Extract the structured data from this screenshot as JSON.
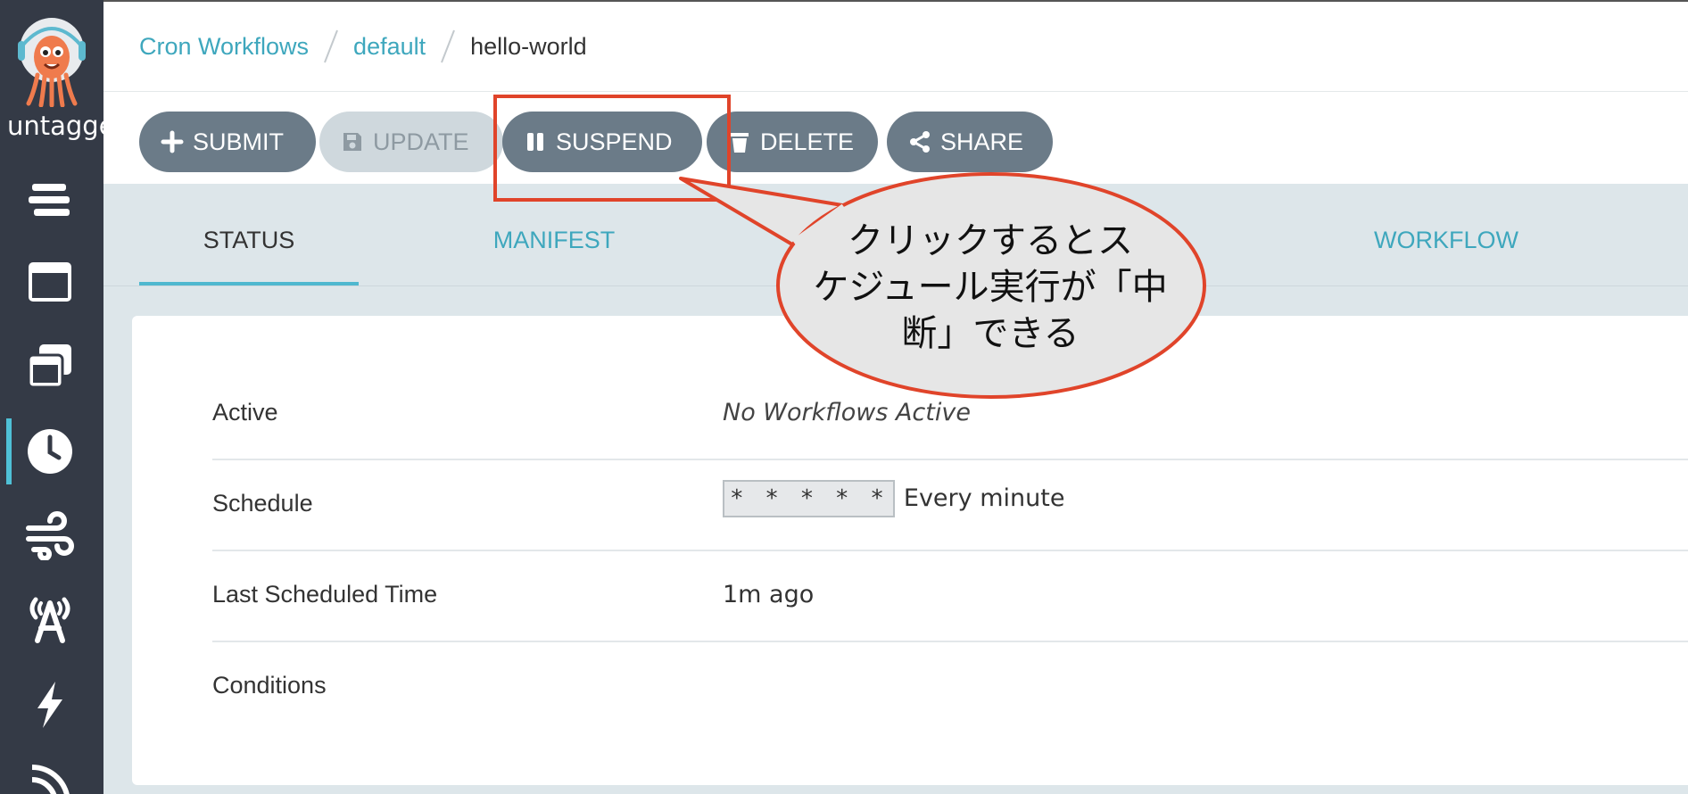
{
  "sidebar": {
    "namespace_label": "untagged",
    "items": [
      {
        "icon": "bars-icon"
      },
      {
        "icon": "window-icon"
      },
      {
        "icon": "stacked-windows-icon"
      },
      {
        "icon": "clock-icon",
        "active": true
      },
      {
        "icon": "wind-icon"
      },
      {
        "icon": "antenna-icon"
      },
      {
        "icon": "bolt-icon"
      },
      {
        "icon": "rss-icon"
      }
    ]
  },
  "breadcrumb": {
    "items": [
      "Cron Workflows",
      "default"
    ],
    "current": "hello-world"
  },
  "toolbar": {
    "submit_label": "SUBMIT",
    "update_label": "UPDATE",
    "suspend_label": "SUSPEND",
    "delete_label": "DELETE",
    "share_label": "SHARE"
  },
  "tabs": {
    "status": "STATUS",
    "manifest": "MANIFEST",
    "workflow": "WORKFLOW",
    "active_tab": "STATUS"
  },
  "details": {
    "active_label": "Active",
    "active_value": "No Workflows Active",
    "schedule_label": "Schedule",
    "schedule_cron": "* * * * *",
    "schedule_desc": "Every minute",
    "last_scheduled_label": "Last Scheduled Time",
    "last_scheduled_value": "1m ago",
    "conditions_label": "Conditions"
  },
  "annotation": {
    "line1": "クリックするとス",
    "line2": "ケジュール実行が「中",
    "line3": "断」できる",
    "color": "#e0442a"
  },
  "colors": {
    "sidebar_bg": "#343a46",
    "accent": "#3ea7bd",
    "button_bg": "#6b7b88"
  }
}
